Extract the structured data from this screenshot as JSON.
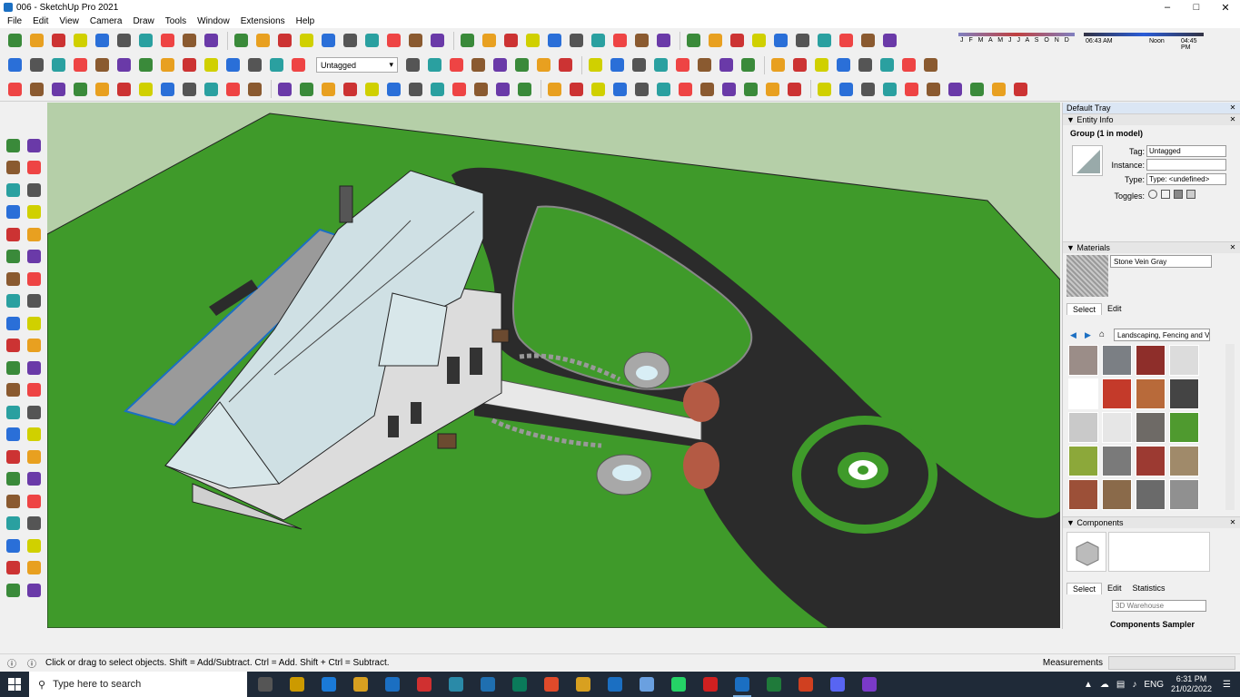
{
  "window": {
    "title": "006 - SketchUp Pro 2021"
  },
  "menu": [
    "File",
    "Edit",
    "View",
    "Camera",
    "Draw",
    "Tools",
    "Window",
    "Extensions",
    "Help"
  ],
  "toolbar": {
    "tag_select": "Untagged"
  },
  "shadows": {
    "months": "J F M A M J J A S O N D",
    "time_start": "06:43 AM",
    "time_noon": "Noon",
    "time_end": "04:45 PM"
  },
  "tray": {
    "title": "Default Tray",
    "entity_info": {
      "heading": "Entity Info",
      "title": "Group (1 in model)",
      "tag_label": "Tag:",
      "tag_value": "Untagged",
      "instance_label": "Instance:",
      "instance_value": "",
      "type_label": "Type:",
      "type_value": "Type: <undefined>",
      "toggles_label": "Toggles:"
    },
    "materials": {
      "heading": "Materials",
      "name": "Stone Vein Gray",
      "tab_select": "Select",
      "tab_edit": "Edit",
      "library": "Landscaping, Fencing and Ve"
    },
    "components": {
      "heading": "Components",
      "tab_select": "Select",
      "tab_edit": "Edit",
      "tab_statistics": "Statistics",
      "search_placeholder": "3D Warehouse",
      "sampler": "Components Sampler"
    }
  },
  "status": {
    "hint": "Click or drag to select objects. Shift = Add/Subtract. Ctrl = Add. Shift + Ctrl = Subtract.",
    "measurements_label": "Measurements"
  },
  "taskbar": {
    "search_placeholder": "Type here to search",
    "language": "ENG",
    "time": "6:31 PM",
    "date": "21/02/2022"
  },
  "colors": {
    "grass": "#3f9a2a",
    "asphalt": "#2b2b2b",
    "roof": "#cfe0e4",
    "wall": "#d8d8d8",
    "accent": "#1b6fc2"
  }
}
